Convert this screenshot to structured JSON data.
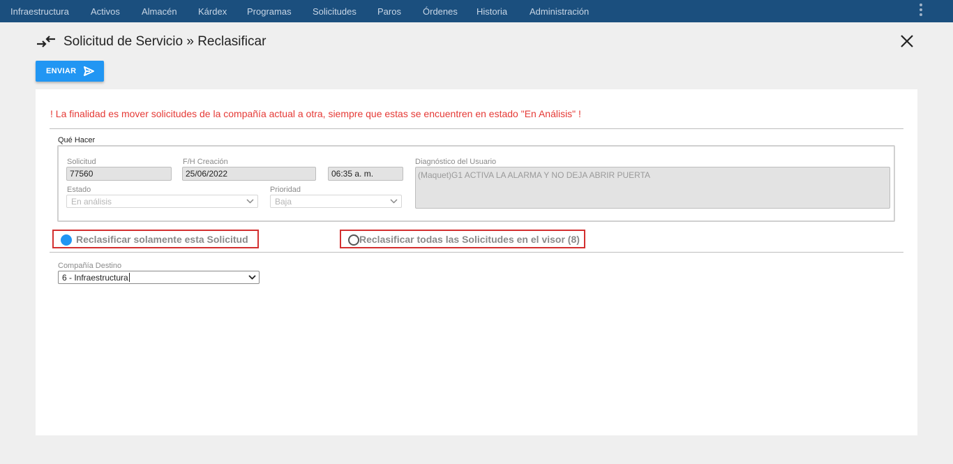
{
  "nav": {
    "items": [
      {
        "label": "Infraestructura"
      },
      {
        "label": "Activos"
      },
      {
        "label": "Almacén"
      },
      {
        "label": "Kárdex"
      },
      {
        "label": "Programas"
      },
      {
        "label": "Solicitudes"
      },
      {
        "label": "Paros"
      },
      {
        "label": "Órdenes"
      },
      {
        "label": "Historia"
      },
      {
        "label": "Administración"
      }
    ],
    "menu_icon": "kebab-vertical-icon"
  },
  "header": {
    "title": "Solicitud de Servicio » Reclasificar",
    "icon": "swap-arrows-icon",
    "close_icon": "close-icon"
  },
  "toolbar": {
    "send_label": "ENVIAR",
    "send_icon": "send-icon"
  },
  "warning": "! La finalidad es mover solicitudes de la compañía actual a otra, siempre que estas se encuentren en estado \"En Análisis\" !",
  "form": {
    "legend": "Qué Hacer",
    "solicitud": {
      "label": "Solicitud",
      "value": "77560"
    },
    "creacion": {
      "label": "F/H Creación",
      "date": "25/06/2022",
      "time": "06:35 a. m."
    },
    "diagnostico": {
      "label": "Diagnóstico del Usuario",
      "value": "(Maquet)G1 ACTIVA LA ALARMA Y NO DEJA ABRIR PUERTA"
    },
    "estado": {
      "label": "Estado",
      "value": "En análisis"
    },
    "prioridad": {
      "label": "Prioridad",
      "value": "Baja"
    }
  },
  "options": {
    "single": {
      "label": "Reclasificar solamente esta Solicitud",
      "selected": true
    },
    "all": {
      "label": "Reclasificar todas las Solicitudes en el visor (8)",
      "selected": false
    }
  },
  "destino": {
    "label": "Compañía Destino",
    "value": "6 - Infraestructura"
  },
  "colors": {
    "nav_bg": "#1b4f7e",
    "accent": "#2196f3",
    "warning": "#e53935",
    "highlight_border": "#d32f2f"
  }
}
